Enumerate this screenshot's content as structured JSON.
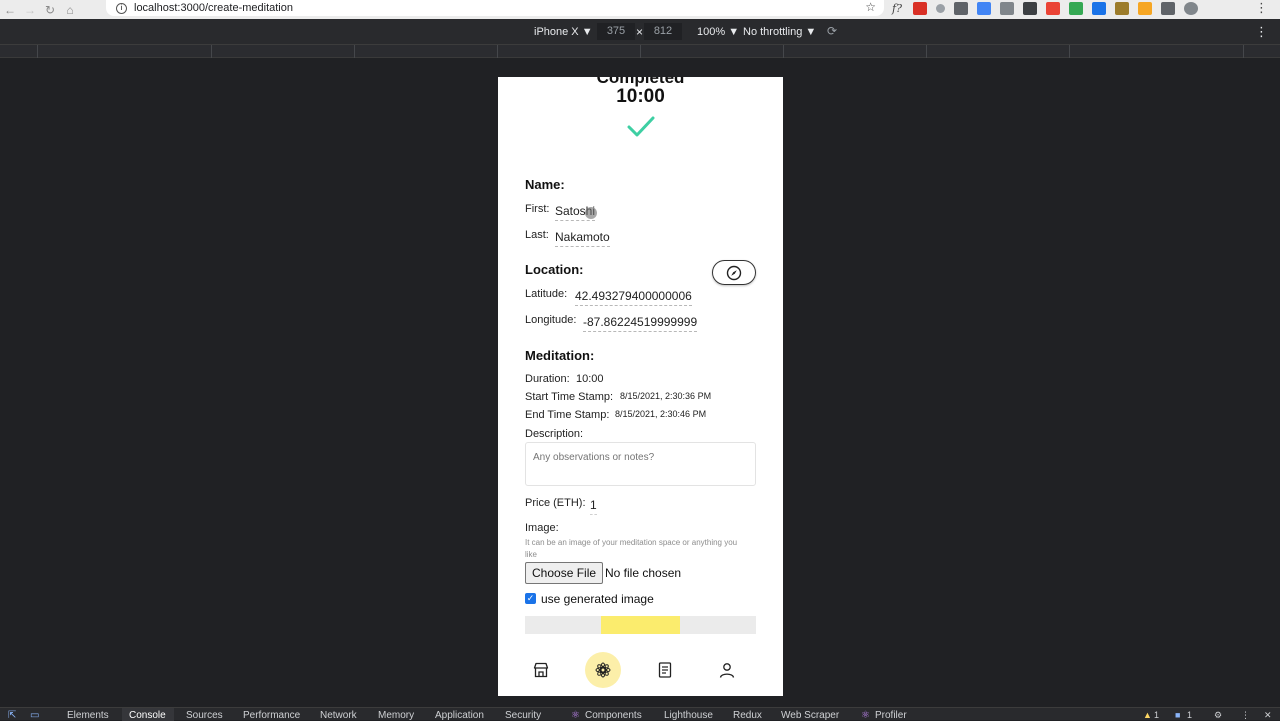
{
  "browser": {
    "url": "localhost:3000/create-meditation",
    "menu_icon": "kebab-icon"
  },
  "device_toolbar": {
    "device": "iPhone X ▼",
    "width": "375",
    "height": "812",
    "separator": "×",
    "zoom": "100% ▼",
    "throttling": "No throttling ▼"
  },
  "app": {
    "header_cut_text": "Completed",
    "timer": "10:00",
    "name_section": {
      "heading": "Name:",
      "first_label": "First:",
      "first_value": "Satoshi",
      "last_label": "Last:",
      "last_value": "Nakamoto"
    },
    "location_section": {
      "heading": "Location:",
      "latitude_label": "Latitude:",
      "latitude_value": "42.493279400000006",
      "longitude_label": "Longitude:",
      "longitude_value": "-87.86224519999999"
    },
    "meditation_section": {
      "heading": "Meditation:",
      "duration_label": "Duration:",
      "duration_value": "10:00",
      "start_label": "Start Time Stamp:",
      "start_value": "8/15/2021, 2:30:36 PM",
      "end_label": "End Time Stamp:",
      "end_value": "8/15/2021, 2:30:46 PM",
      "description_label": "Description:",
      "description_placeholder": "Any observations or notes?",
      "price_label": "Price (ETH):",
      "price_value": "1",
      "image_label": "Image:",
      "image_hint": "It can be an image of your meditation space or anything you like",
      "choose_file_label": "Choose File",
      "no_file_text": "No file chosen",
      "generated_label": "use generated image",
      "generated_checked": true,
      "progress_start": 0.33,
      "progress_end": 0.67
    },
    "colors": {
      "check": "#3ecfa3",
      "progress_fill": "#fbec6d",
      "active_nav_bg": "#fcefa9"
    },
    "bottom_nav": [
      {
        "icon": "store-icon",
        "active": false
      },
      {
        "icon": "meditation-icon",
        "active": true
      },
      {
        "icon": "document-icon",
        "active": false
      },
      {
        "icon": "user-icon",
        "active": false
      }
    ]
  },
  "devtools_tabs": [
    "Elements",
    "Console",
    "Sources",
    "Performance",
    "Network",
    "Memory",
    "Application",
    "Security",
    "Components",
    "Lighthouse",
    "Redux",
    "Web Scraper",
    "Profiler"
  ],
  "devtools_active_tab": "Console",
  "devtools_counts": {
    "warnings": "1",
    "info": "1"
  }
}
